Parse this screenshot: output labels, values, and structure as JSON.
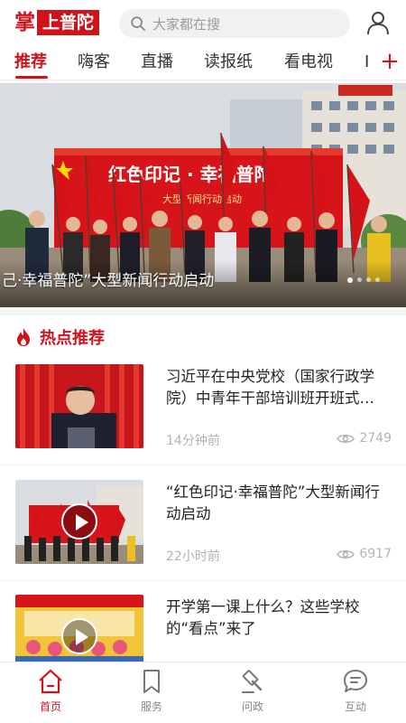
{
  "header": {
    "logo_char": "掌",
    "logo_box_text": "上普陀",
    "search_placeholder": "大家都在搜"
  },
  "tabs": [
    {
      "label": "推荐",
      "active": true
    },
    {
      "label": "嗨客"
    },
    {
      "label": "直播"
    },
    {
      "label": "读报纸"
    },
    {
      "label": "看电视"
    },
    {
      "label": "I"
    }
  ],
  "tab_plus": "+",
  "banner": {
    "caption": "己·幸福普陀”大型新闻行动启动",
    "slide_count": 4,
    "active_slide": 1,
    "sign_text": "红色印记·幸福普陀",
    "sign_sub": "大型新闻行动启动"
  },
  "section": {
    "title": "热点推荐"
  },
  "news": [
    {
      "title": "习近平在中央党校（国家行政学院）中青年干部培训班开班式…",
      "time": "14分钟前",
      "views": "2749",
      "video": false
    },
    {
      "title": "“红色印记·幸福普陀”大型新闻行动启动",
      "time": "22小时前",
      "views": "6917",
      "video": true
    },
    {
      "title": "开学第一课上什么？这些学校的“看点”来了",
      "time": "",
      "views": "",
      "video": true
    }
  ],
  "bottom_nav": [
    {
      "label": "首页",
      "icon": "home-icon",
      "active": true
    },
    {
      "label": "服务",
      "icon": "bookmark-icon"
    },
    {
      "label": "问政",
      "icon": "gavel-icon"
    },
    {
      "label": "互动",
      "icon": "chat-icon"
    }
  ],
  "colors": {
    "brand": "#d0121b",
    "muted": "#b3b3b3"
  }
}
